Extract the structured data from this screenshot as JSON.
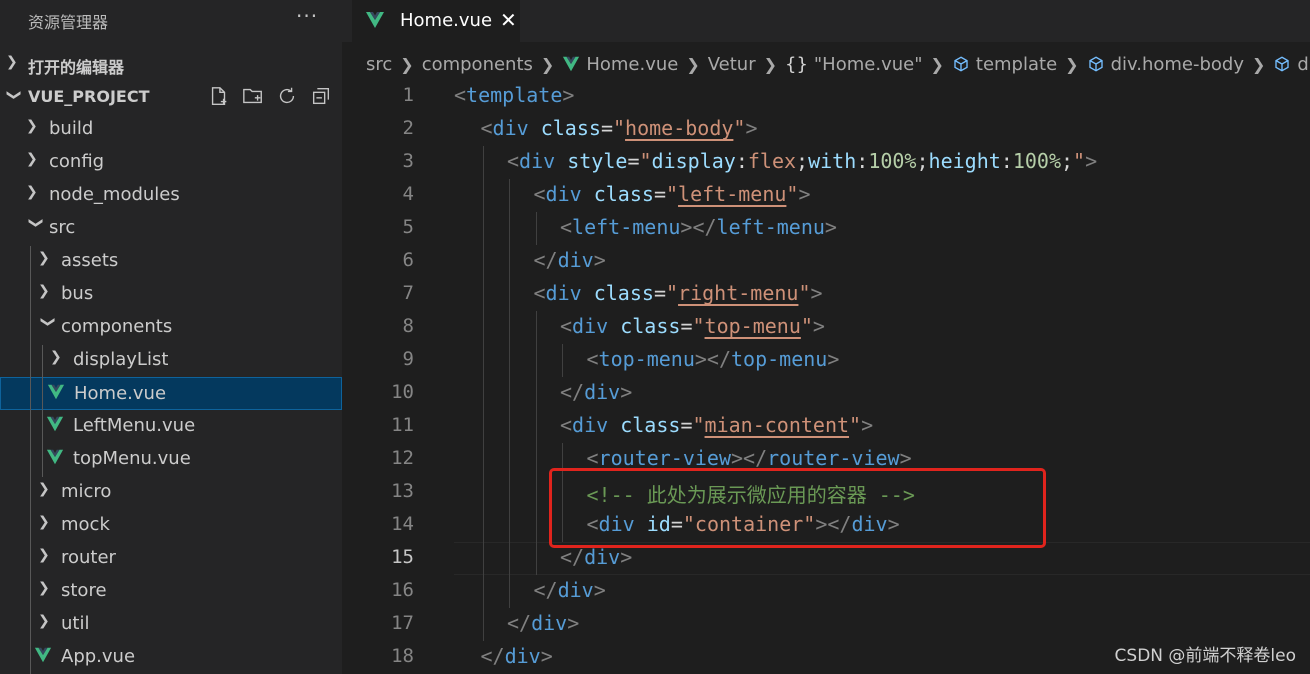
{
  "explorer": {
    "title": "资源管理器",
    "more_label": "···",
    "open_editors_label": "打开的编辑器",
    "project_label": "VUE_PROJECT",
    "tree": [
      {
        "label": "build",
        "type": "folder",
        "expanded": false,
        "depth": 0
      },
      {
        "label": "config",
        "type": "folder",
        "expanded": false,
        "depth": 0
      },
      {
        "label": "node_modules",
        "type": "folder",
        "expanded": false,
        "depth": 0
      },
      {
        "label": "src",
        "type": "folder",
        "expanded": true,
        "depth": 0
      },
      {
        "label": "assets",
        "type": "folder",
        "expanded": false,
        "depth": 1
      },
      {
        "label": "bus",
        "type": "folder",
        "expanded": false,
        "depth": 1
      },
      {
        "label": "components",
        "type": "folder",
        "expanded": true,
        "depth": 1
      },
      {
        "label": "displayList",
        "type": "folder",
        "expanded": false,
        "depth": 2
      },
      {
        "label": "Home.vue",
        "type": "vue",
        "selected": true,
        "depth": 2
      },
      {
        "label": "LeftMenu.vue",
        "type": "vue",
        "depth": 2
      },
      {
        "label": "topMenu.vue",
        "type": "vue",
        "depth": 2
      },
      {
        "label": "micro",
        "type": "folder",
        "expanded": false,
        "depth": 1
      },
      {
        "label": "mock",
        "type": "folder",
        "expanded": false,
        "depth": 1
      },
      {
        "label": "router",
        "type": "folder",
        "expanded": false,
        "depth": 1
      },
      {
        "label": "store",
        "type": "folder",
        "expanded": false,
        "depth": 1
      },
      {
        "label": "util",
        "type": "folder",
        "expanded": false,
        "depth": 1
      },
      {
        "label": "App.vue",
        "type": "vue",
        "depth": 1
      }
    ]
  },
  "tab": {
    "name": "Home.vue",
    "close": "✕"
  },
  "breadcrumb": {
    "src": "src",
    "components": "components",
    "file": "Home.vue",
    "vetur": "Vetur",
    "braces": "{}",
    "quoted": "\"Home.vue\"",
    "template": "template",
    "homebody": "div.home-body",
    "div": "div"
  },
  "code_lines": [
    {
      "n": "1",
      "indent": 0,
      "tokens": [
        [
          "t-br",
          "<"
        ],
        [
          "t-tag",
          "template"
        ],
        [
          "t-br",
          ">"
        ]
      ]
    },
    {
      "n": "2",
      "indent": 1,
      "tokens": [
        [
          "t-br",
          "<"
        ],
        [
          "t-tag",
          "div"
        ],
        [
          "t-punc",
          " "
        ],
        [
          "t-attr",
          "class"
        ],
        [
          "t-eq",
          "="
        ],
        [
          "t-str",
          "\""
        ],
        [
          "t-str-u",
          "home-body"
        ],
        [
          "t-str",
          "\""
        ],
        [
          "t-br",
          ">"
        ]
      ]
    },
    {
      "n": "3",
      "indent": 2,
      "tokens": [
        [
          "t-br",
          "<"
        ],
        [
          "t-tag",
          "div"
        ],
        [
          "t-punc",
          " "
        ],
        [
          "t-attr",
          "style"
        ],
        [
          "t-eq",
          "="
        ],
        [
          "t-str",
          "\""
        ],
        [
          "t-prop",
          "display"
        ],
        [
          "t-punc",
          ":"
        ],
        [
          "t-val",
          "flex"
        ],
        [
          "t-punc",
          ";"
        ],
        [
          "t-prop",
          "with"
        ],
        [
          "t-punc",
          ":"
        ],
        [
          "t-num",
          "100%"
        ],
        [
          "t-punc",
          ";"
        ],
        [
          "t-prop",
          "height"
        ],
        [
          "t-punc",
          ":"
        ],
        [
          "t-num",
          "100%"
        ],
        [
          "t-punc",
          ";"
        ],
        [
          "t-str",
          "\""
        ],
        [
          "t-br",
          ">"
        ]
      ]
    },
    {
      "n": "4",
      "indent": 3,
      "tokens": [
        [
          "t-br",
          "<"
        ],
        [
          "t-tag",
          "div"
        ],
        [
          "t-punc",
          " "
        ],
        [
          "t-attr",
          "class"
        ],
        [
          "t-eq",
          "="
        ],
        [
          "t-str",
          "\""
        ],
        [
          "t-str-u",
          "left-menu"
        ],
        [
          "t-str",
          "\""
        ],
        [
          "t-br",
          ">"
        ]
      ]
    },
    {
      "n": "5",
      "indent": 4,
      "tokens": [
        [
          "t-br",
          "<"
        ],
        [
          "t-tag",
          "left-menu"
        ],
        [
          "t-br",
          "></"
        ],
        [
          "t-tag",
          "left-menu"
        ],
        [
          "t-br",
          ">"
        ]
      ]
    },
    {
      "n": "6",
      "indent": 3,
      "tokens": [
        [
          "t-br",
          "</"
        ],
        [
          "t-tag",
          "div"
        ],
        [
          "t-br",
          ">"
        ]
      ]
    },
    {
      "n": "7",
      "indent": 3,
      "tokens": [
        [
          "t-br",
          "<"
        ],
        [
          "t-tag",
          "div"
        ],
        [
          "t-punc",
          " "
        ],
        [
          "t-attr",
          "class"
        ],
        [
          "t-eq",
          "="
        ],
        [
          "t-str",
          "\""
        ],
        [
          "t-str-u",
          "right-menu"
        ],
        [
          "t-str",
          "\""
        ],
        [
          "t-br",
          ">"
        ]
      ]
    },
    {
      "n": "8",
      "indent": 4,
      "tokens": [
        [
          "t-br",
          "<"
        ],
        [
          "t-tag",
          "div"
        ],
        [
          "t-punc",
          " "
        ],
        [
          "t-attr",
          "class"
        ],
        [
          "t-eq",
          "="
        ],
        [
          "t-str",
          "\""
        ],
        [
          "t-str-u",
          "top-menu"
        ],
        [
          "t-str",
          "\""
        ],
        [
          "t-br",
          ">"
        ]
      ]
    },
    {
      "n": "9",
      "indent": 5,
      "tokens": [
        [
          "t-br",
          "<"
        ],
        [
          "t-tag",
          "top-menu"
        ],
        [
          "t-br",
          "></"
        ],
        [
          "t-tag",
          "top-menu"
        ],
        [
          "t-br",
          ">"
        ]
      ]
    },
    {
      "n": "10",
      "indent": 4,
      "tokens": [
        [
          "t-br",
          "</"
        ],
        [
          "t-tag",
          "div"
        ],
        [
          "t-br",
          ">"
        ]
      ]
    },
    {
      "n": "11",
      "indent": 4,
      "tokens": [
        [
          "t-br",
          "<"
        ],
        [
          "t-tag",
          "div"
        ],
        [
          "t-punc",
          " "
        ],
        [
          "t-attr",
          "class"
        ],
        [
          "t-eq",
          "="
        ],
        [
          "t-str",
          "\""
        ],
        [
          "t-str-u",
          "mian-content"
        ],
        [
          "t-str",
          "\""
        ],
        [
          "t-br",
          ">"
        ]
      ]
    },
    {
      "n": "12",
      "indent": 5,
      "tokens": [
        [
          "t-br",
          "<"
        ],
        [
          "t-tag",
          "router-view"
        ],
        [
          "t-br",
          "></"
        ],
        [
          "t-tag",
          "router-view"
        ],
        [
          "t-br",
          ">"
        ]
      ]
    },
    {
      "n": "13",
      "indent": 5,
      "tokens": [
        [
          "t-com",
          "<!-- 此处为展示微应用的容器 -->"
        ]
      ]
    },
    {
      "n": "14",
      "indent": 5,
      "tokens": [
        [
          "t-br",
          "<"
        ],
        [
          "t-tag",
          "div"
        ],
        [
          "t-punc",
          " "
        ],
        [
          "t-attr",
          "id"
        ],
        [
          "t-eq",
          "="
        ],
        [
          "t-str",
          "\"container\""
        ],
        [
          "t-br",
          "></"
        ],
        [
          "t-tag",
          "div"
        ],
        [
          "t-br",
          ">"
        ]
      ]
    },
    {
      "n": "15",
      "indent": 4,
      "current": true,
      "tokens": [
        [
          "t-br",
          "</"
        ],
        [
          "t-tag",
          "div"
        ],
        [
          "t-br",
          ">"
        ]
      ]
    },
    {
      "n": "16",
      "indent": 3,
      "tokens": [
        [
          "t-br",
          "</"
        ],
        [
          "t-tag",
          "div"
        ],
        [
          "t-br",
          ">"
        ]
      ]
    },
    {
      "n": "17",
      "indent": 2,
      "tokens": [
        [
          "t-br",
          "</"
        ],
        [
          "t-tag",
          "div"
        ],
        [
          "t-br",
          ">"
        ]
      ]
    },
    {
      "n": "18",
      "indent": 1,
      "tokens": [
        [
          "t-br",
          "</"
        ],
        [
          "t-tag",
          "div"
        ],
        [
          "t-br",
          ">"
        ]
      ]
    }
  ],
  "watermark": "CSDN @前端不释卷leo",
  "colors": {
    "highlight_box": "#e0241d",
    "vue_green": "#41b883",
    "selected_bg": "#04395e"
  }
}
